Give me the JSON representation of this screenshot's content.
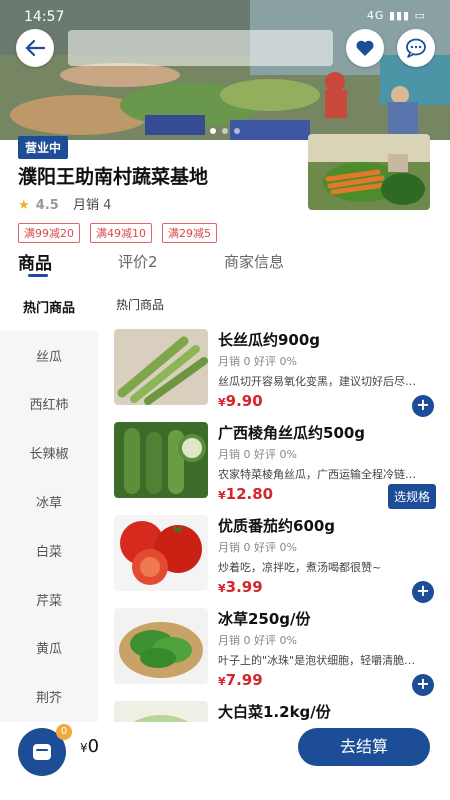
{
  "status_bar": {
    "time": "14:57",
    "system": "4G ▮▮▮ ▭"
  },
  "store": {
    "open_status": "营业中",
    "name": "濮阳王助南村蔬菜基地",
    "rating": "4.5",
    "sales_label": "月销",
    "sales_count": "4",
    "coupons": [
      "满99减20",
      "满49减10",
      "满29减5"
    ]
  },
  "tabs": [
    {
      "label": "商品",
      "active": true
    },
    {
      "label": "评价2",
      "active": false
    },
    {
      "label": "商家信息",
      "active": false
    }
  ],
  "sidebar": {
    "items": [
      "热门商品",
      "丝瓜",
      "西红柿",
      "长辣椒",
      "冰草",
      "白菜",
      "芹菜",
      "黄瓜",
      "荆芥"
    ],
    "active_index": 0
  },
  "section_title": "热门商品",
  "products": [
    {
      "name": "长丝瓜约900g",
      "stats": "月销 0  好评 0%",
      "desc": "丝瓜切开容易氧化变黑，建议切好后尽快烹饪",
      "currency": "¥",
      "price": "9.90",
      "action": "add"
    },
    {
      "name": "广西棱角丝瓜约500g",
      "stats": "月销 0  好评 0%",
      "desc": "农家特菜棱角丝瓜，广西运输全程冷链保鲜",
      "currency": "¥",
      "price": "12.80",
      "action": "spec",
      "spec_label": "选规格"
    },
    {
      "name": "优质番茄约600g",
      "stats": "月销 0  好评 0%",
      "desc": "炒着吃，凉拌吃，煮汤喝都很赞~",
      "currency": "¥",
      "price": "3.99",
      "action": "add"
    },
    {
      "name": "冰草250g/份",
      "stats": "月销 0  好评 0%",
      "desc": "叶子上的\"冰珠\"是泡状细胞，轻嚼清脆多汁",
      "currency": "¥",
      "price": "7.99",
      "action": "add"
    },
    {
      "name": "大白菜1.2kg/份",
      "stats": "",
      "desc": "",
      "currency": "",
      "price": "",
      "action": "none"
    }
  ],
  "cart": {
    "badge": "0",
    "currency": "¥",
    "total": "0",
    "checkout_label": "去结算"
  },
  "colors": {
    "brand": "#1e4d97",
    "price": "#d4262c",
    "coupon": "#d9484f",
    "badge": "#f2a93b"
  }
}
